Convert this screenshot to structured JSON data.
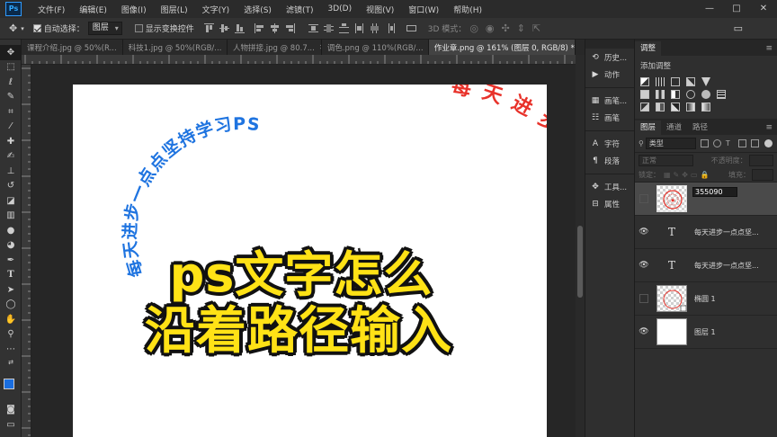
{
  "app": {
    "logo": "Ps"
  },
  "menu": [
    "文件(F)",
    "编辑(E)",
    "图像(I)",
    "图层(L)",
    "文字(Y)",
    "选择(S)",
    "滤镜(T)",
    "3D(D)",
    "视图(V)",
    "窗口(W)",
    "帮助(H)"
  ],
  "window_controls": {
    "minimize": "—",
    "maximize": "□",
    "close": "✕"
  },
  "options": {
    "auto_select_label": "自动选择：",
    "auto_select_value": "图层",
    "show_transform_label": "显示变换控件",
    "mode_3d_label": "3D 模式："
  },
  "tabs": [
    {
      "label": "课程介绍.jpg @ 50%(R...",
      "active": false
    },
    {
      "label": "科技1.jpg @ 50%(RGB/...",
      "active": false
    },
    {
      "label": "人物拼接.jpg @ 80.7...",
      "active": false
    },
    {
      "label": "调色.png @ 110%(RGB/...",
      "active": false
    },
    {
      "label": "作业章.png @ 161% (图层 0, RGB/8) *",
      "active": true
    }
  ],
  "canvas": {
    "blue_arc_text": "每天进步一点点坚持学习PS",
    "red_arc_text": "每天进步一点点坚持学习PS",
    "blue_color": "#1f74e0",
    "red_color": "#e8322a"
  },
  "overlay": {
    "line1": "ps文字怎么",
    "line2": "沿着路径输入",
    "fill_color": "#ffe216",
    "stroke_color": "#111111"
  },
  "mini_panels": [
    {
      "icon": "history-icon",
      "label": "历史..."
    },
    {
      "icon": "actions-icon",
      "label": "动作"
    },
    {
      "icon": "brushes-icon",
      "label": "画笔..."
    },
    {
      "icon": "brush-settings-icon",
      "label": "画笔"
    },
    {
      "icon": "character-icon",
      "label": "字符"
    },
    {
      "icon": "paragraph-icon",
      "label": "段落"
    },
    {
      "icon": "tools-icon",
      "label": "工具..."
    },
    {
      "icon": "properties-icon",
      "label": "属性"
    }
  ],
  "adjust_panel": {
    "tab": "调整",
    "title": "添加调整"
  },
  "layers_panel": {
    "tabs": [
      "图层",
      "通道",
      "路径"
    ],
    "filter_label": "类型",
    "blend_mode": "正常",
    "opacity_label": "不透明度：",
    "lock_label": "锁定：",
    "fill_label": "填充：",
    "layers": [
      {
        "name": "355090",
        "type": "smart",
        "visible": false,
        "selected": true,
        "editing": true
      },
      {
        "name": "每天进步一点点坚...",
        "type": "text",
        "visible": true,
        "selected": false
      },
      {
        "name": "每天进步一点点坚...",
        "type": "text",
        "visible": true,
        "selected": false
      },
      {
        "name": "椭圆 1",
        "type": "shape",
        "visible": false,
        "selected": false
      },
      {
        "name": "图层 1",
        "type": "pixel",
        "visible": true,
        "selected": false
      }
    ]
  },
  "colors": {
    "foreground": "#1a6ee0",
    "background": "#ffffff"
  }
}
